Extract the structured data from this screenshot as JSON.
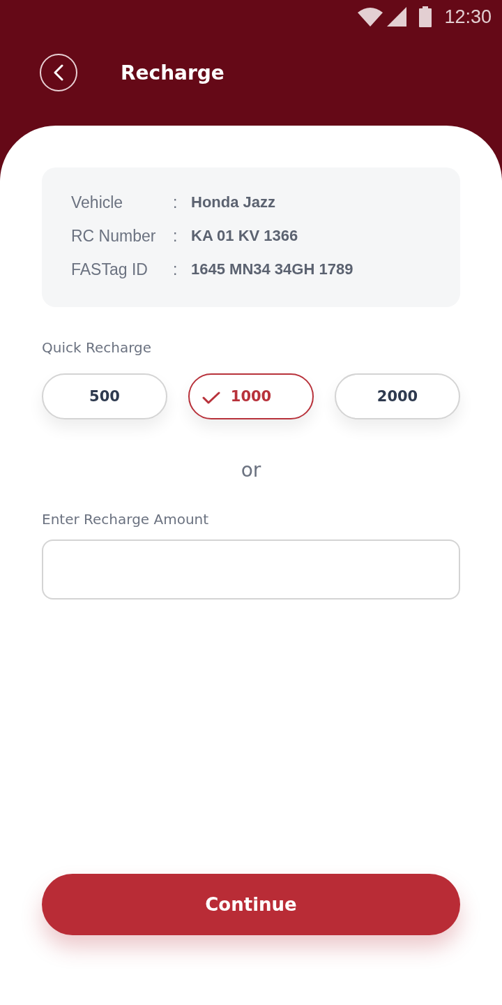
{
  "status_bar": {
    "time": "12:30"
  },
  "header": {
    "title": "Recharge"
  },
  "vehicle_info": [
    {
      "label": "Vehicle",
      "separator": ":",
      "value": "Honda Jazz"
    },
    {
      "label": "RC Number",
      "separator": ":",
      "value": "KA 01 KV 1366"
    },
    {
      "label": "FASTag ID",
      "separator": ":",
      "value": "1645 MN34 34GH 1789"
    }
  ],
  "quick_recharge": {
    "label": "Quick Recharge",
    "options": [
      {
        "amount": "500",
        "selected": false
      },
      {
        "amount": "1000",
        "selected": true
      },
      {
        "amount": "2000",
        "selected": false
      }
    ]
  },
  "divider_text": "or",
  "amount_field": {
    "label": "Enter Recharge Amount"
  },
  "primary_button": {
    "label": "Continue"
  }
}
